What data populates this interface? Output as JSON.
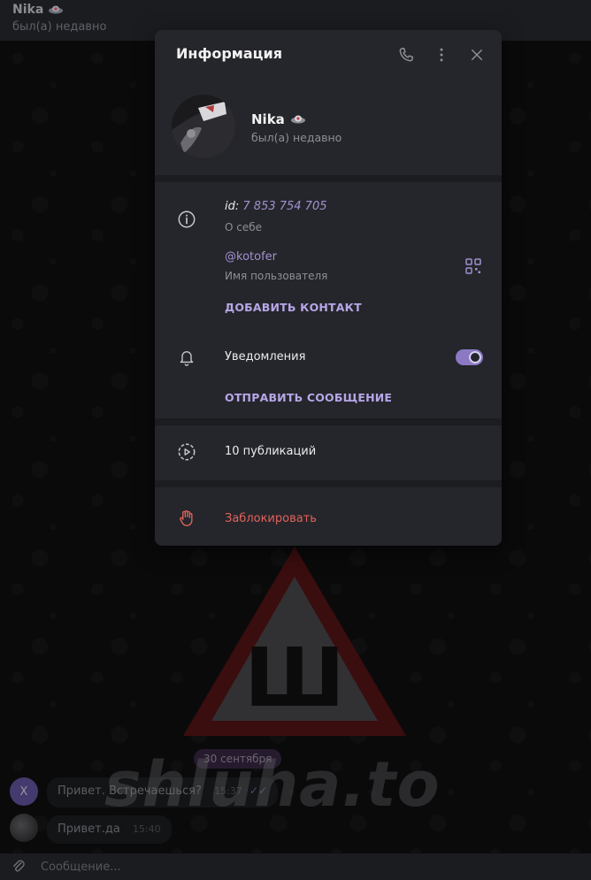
{
  "chat": {
    "title": "Nika",
    "status": "был(а) недавно",
    "date_badge": "30 сентября",
    "messages": [
      {
        "avatar_letter": "X",
        "text": "Привет. Встречаешься?",
        "time": "15:37"
      },
      {
        "text": "Привет.да",
        "time": "15:40"
      }
    ],
    "composer_placeholder": "Сообщение...",
    "sign_letter": "Ш",
    "watermark": "shluha.to"
  },
  "dialog": {
    "title": "Информация",
    "user_name": "Nika",
    "user_status": "был(а) недавно",
    "id_label": "id:",
    "id_value": "7 853 754 705",
    "about_label": "О себе",
    "username": "@kotofer",
    "username_label": "Имя пользователя",
    "add_contact": "ДОБАВИТЬ КОНТАКТ",
    "notifications_label": "Уведомления",
    "notifications_enabled": true,
    "send_message": "ОТПРАВИТЬ СООБЩЕНИЕ",
    "posts": "10 публикаций",
    "block": "Заблокировать"
  },
  "icons": [
    "phone-icon",
    "more-vertical-icon",
    "close-icon",
    "info-icon",
    "qr-code-icon",
    "bell-icon",
    "stories-icon",
    "hand-block-icon",
    "attach-icon",
    "read-ticks-icon"
  ],
  "colors": {
    "accent": "#b7a6e8",
    "toggle": "#8b79c4",
    "danger": "#e2625a",
    "dialog_bg": "#25262b"
  }
}
